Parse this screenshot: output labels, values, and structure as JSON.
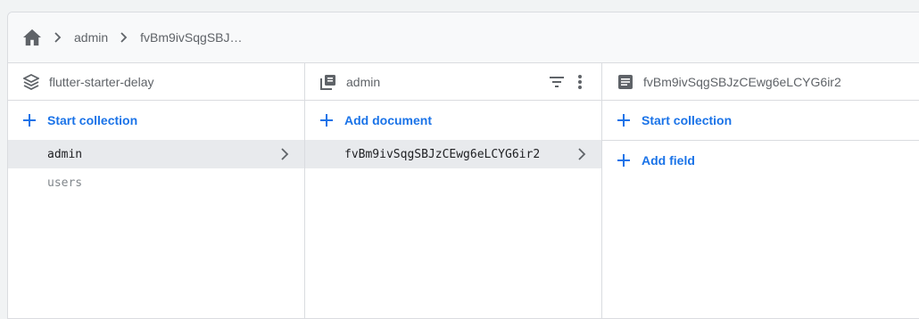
{
  "breadcrumb": {
    "items": [
      "admin",
      "fvBm9ivSqgSBJ…"
    ]
  },
  "panels": {
    "root": {
      "title": "flutter-starter-delay",
      "action_label": "Start collection",
      "items": [
        {
          "label": "admin",
          "selected": true
        },
        {
          "label": "users",
          "selected": false
        }
      ]
    },
    "collection": {
      "title": "admin",
      "action_label": "Add document",
      "items": [
        {
          "label": "fvBm9ivSqgSBJzCEwg6eLCYG6ir2",
          "selected": true
        }
      ]
    },
    "document": {
      "title": "fvBm9ivSqgSBJzCEwg6eLCYG6ir2",
      "start_collection_label": "Start collection",
      "add_field_label": "Add field"
    }
  },
  "colors": {
    "accent": "#1a73e8",
    "selected_row": "#e8eaed",
    "border": "#dadce0"
  },
  "icons": {
    "home": "home-icon",
    "breadcrumb_sep": "chevron-right-icon",
    "root_header": "database-stack-icon",
    "collection_header": "collection-icon",
    "document_header": "document-icon",
    "filter": "filter-icon",
    "more": "more-vert-icon",
    "add": "plus-icon"
  }
}
